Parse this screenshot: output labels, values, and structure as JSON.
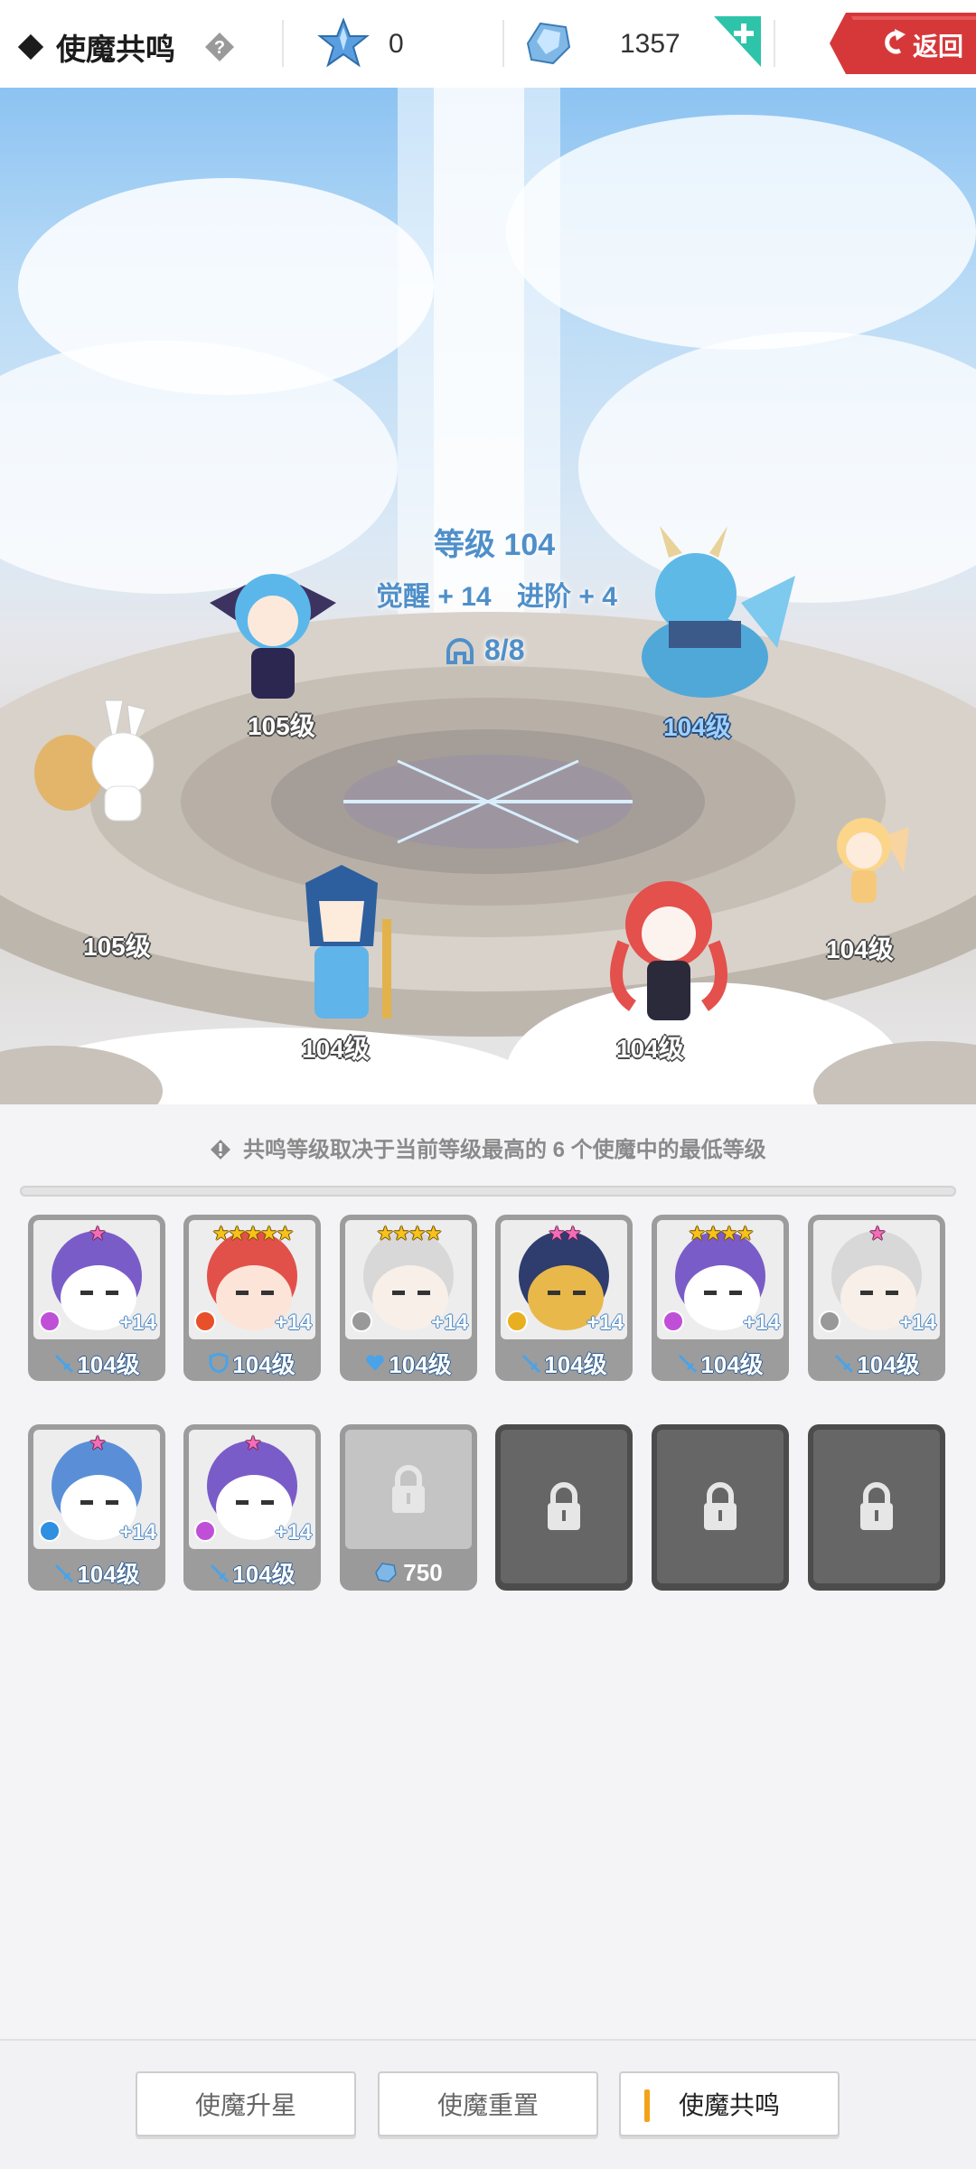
{
  "header": {
    "title": "使魔共鸣",
    "star_count": "0",
    "gem_count": "1357",
    "back_label": "返回"
  },
  "resonance": {
    "level_text": "等级 104",
    "awaken_text": "觉醒 + 14",
    "advance_text": "进阶 + 4",
    "slots_text": "8/8"
  },
  "scene_heroes": [
    {
      "level": "105级"
    },
    {
      "level": "104级"
    },
    {
      "level": "105级"
    },
    {
      "level": "104级"
    },
    {
      "level": "104级"
    },
    {
      "level": "104级"
    },
    {
      "level": "104级"
    }
  ],
  "info_text": "共鸣等级取决于当前等级最高的 6 个使魔中的最低等级",
  "cards_row1": [
    {
      "stars": "★",
      "star_color": "pink",
      "plus": "+14",
      "level": "104级",
      "class": "sword",
      "element": "dark"
    },
    {
      "stars": "★★★★★",
      "star_color": "gold",
      "plus": "+14",
      "level": "104级",
      "class": "shield",
      "element": "fire"
    },
    {
      "stars": "★★★★",
      "star_color": "gold",
      "plus": "+14",
      "level": "104级",
      "class": "heart",
      "element": "light"
    },
    {
      "stars": "★★",
      "star_color": "pink",
      "plus": "+14",
      "level": "104级",
      "class": "sword",
      "element": "wind"
    },
    {
      "stars": "★★★★",
      "star_color": "gold",
      "plus": "+14",
      "level": "104级",
      "class": "sword",
      "element": "dark"
    },
    {
      "stars": "★",
      "star_color": "pink",
      "plus": "+14",
      "level": "104级",
      "class": "sword",
      "element": "light"
    }
  ],
  "cards_row2": [
    {
      "stars": "★",
      "star_color": "pink",
      "plus": "+14",
      "level": "104级",
      "class": "sword",
      "element": "water"
    },
    {
      "stars": "★",
      "star_color": "pink",
      "plus": "+14",
      "level": "104级",
      "class": "sword",
      "element": "dark"
    }
  ],
  "unlock_cost": "750",
  "tabs": {
    "upgrade": "使魔升星",
    "reset": "使魔重置",
    "resonance": "使魔共鸣"
  },
  "colors": {
    "accent_red": "#d6383a",
    "accent_teal": "#2ec4a9",
    "level_blue": "#4f8fc9",
    "active_tab_bar": "#f2a31a"
  }
}
